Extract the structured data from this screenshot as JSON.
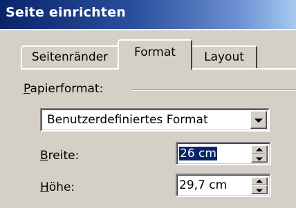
{
  "dialog": {
    "title": "Seite einrichten"
  },
  "tabs": [
    {
      "label": "Seitenränder",
      "active": false
    },
    {
      "label": "Format",
      "active": true
    },
    {
      "label": "Layout",
      "active": false
    }
  ],
  "paper_size": {
    "label_accel": "P",
    "label_rest": "apierformat:",
    "selected_value": "Benutzerdefiniertes Format"
  },
  "width_field": {
    "label_accel": "B",
    "label_rest": "reite:",
    "value": "26 cm"
  },
  "height_field": {
    "label_accel": "H",
    "label_rest": "öhe:",
    "value": "29,7 cm"
  },
  "colors": {
    "titlebar_start": "#0a246a",
    "titlebar_end": "#a6caf0",
    "face": "#d4d0c8",
    "selection": "#0a246a"
  }
}
